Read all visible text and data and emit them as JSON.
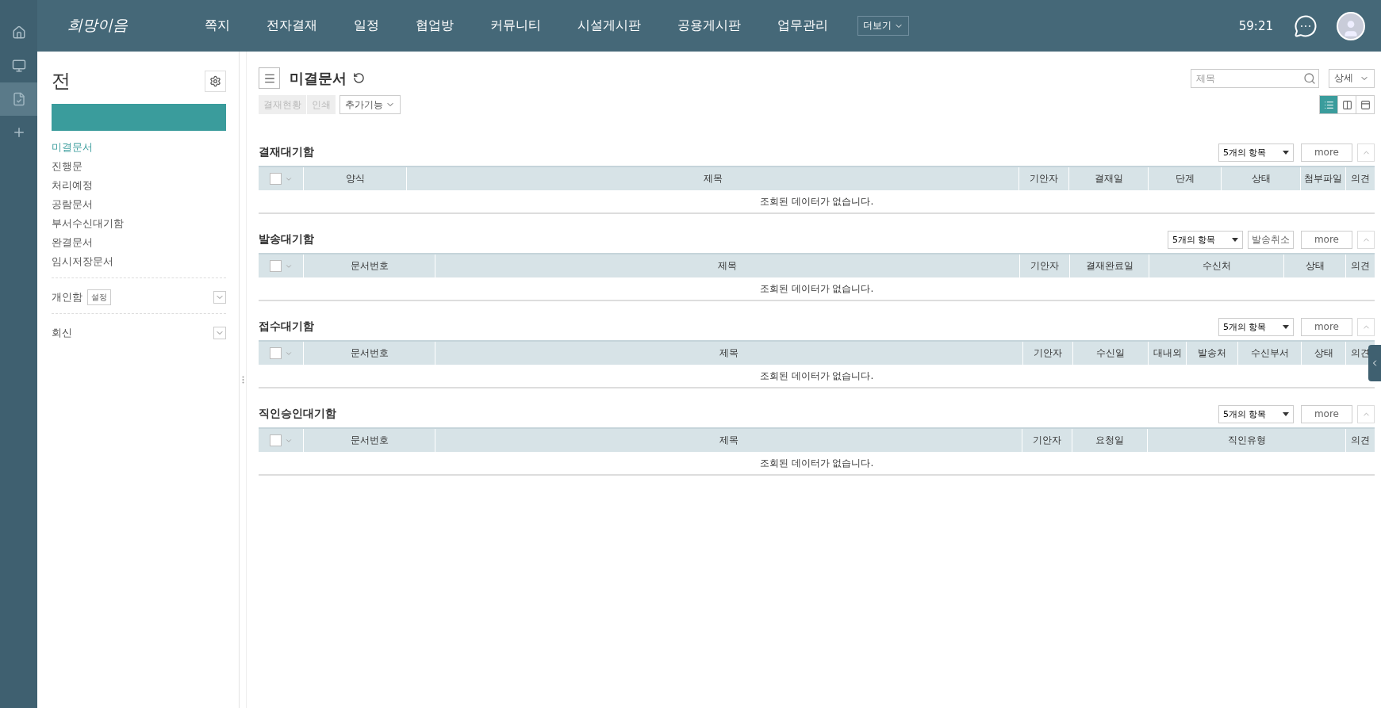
{
  "rail": {
    "items": [
      {
        "kind": "home",
        "selected": false
      },
      {
        "kind": "board",
        "selected": false
      },
      {
        "kind": "approval",
        "selected": true
      },
      {
        "kind": "add",
        "selected": false
      }
    ]
  },
  "topbar": {
    "logo": "희망이음",
    "nav": [
      "쪽지",
      "전자결재",
      "일정",
      "협업방",
      "커뮤니티",
      "시설게시판",
      "공용게시판",
      "업무관리"
    ],
    "more": "더보기",
    "time": "59:21"
  },
  "sidebar": {
    "title": "전",
    "menu": [
      {
        "label": "미결문서",
        "selected": true
      },
      {
        "label": "진행문",
        "selected": false
      },
      {
        "label": "처리예정",
        "selected": false
      },
      {
        "label": "공람문서",
        "selected": false
      },
      {
        "label": "부서수신대기함",
        "selected": false
      },
      {
        "label": "완결문서",
        "selected": false
      },
      {
        "label": "임시저장문서",
        "selected": false
      }
    ],
    "groups": [
      {
        "label": "개인함",
        "badge": "설정",
        "expanded": false
      },
      {
        "label": "회신",
        "expanded": false
      }
    ]
  },
  "page": {
    "title": "미결문서",
    "search": {
      "placeholder": "제목"
    },
    "detail": "상세",
    "actions": [
      {
        "label": "결재현황",
        "disabled": true
      },
      {
        "label": "인쇄",
        "disabled": true
      }
    ],
    "extra": "추가기능",
    "views": [
      {
        "kind": "list",
        "selected": true
      },
      {
        "kind": "split",
        "selected": false
      },
      {
        "kind": "full",
        "selected": false
      }
    ]
  },
  "sections": [
    {
      "title": "결재대기함",
      "select_all": {
        "checked": false
      },
      "page_size": "5개의 항목",
      "buttons": [
        "more"
      ],
      "columns": [
        "양식",
        "제목",
        "기안자",
        "결재일",
        "단계",
        "상태",
        "첨부파일",
        "의견"
      ],
      "empty": "조회된 데이터가 없습니다."
    },
    {
      "title": "발송대기함",
      "select_all": {
        "checked": false
      },
      "page_size": "5개의 항목",
      "buttons": [
        "발송취소",
        "more"
      ],
      "columns": [
        "문서번호",
        "제목",
        "기안자",
        "결재완료일",
        "수신처",
        "상태",
        "의견"
      ],
      "empty": "조회된 데이터가 없습니다."
    },
    {
      "title": "접수대기함",
      "select_all": {
        "checked": false
      },
      "page_size": "5개의 항목",
      "buttons": [
        "more"
      ],
      "columns": [
        "문서번호",
        "제목",
        "기안자",
        "수신일",
        "대내외",
        "발송처",
        "수신부서",
        "상태",
        "의견"
      ],
      "empty": "조회된 데이터가 없습니다."
    },
    {
      "title": "직인승인대기함",
      "select_all": {
        "checked": false
      },
      "page_size": "5개의 항목",
      "buttons": [
        "more"
      ],
      "columns": [
        "문서번호",
        "제목",
        "기안자",
        "요청일",
        "직인유형",
        "의견"
      ],
      "empty": "조회된 데이터가 없습니다."
    }
  ]
}
